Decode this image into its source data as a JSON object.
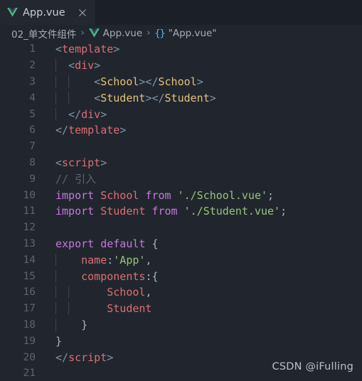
{
  "tab": {
    "icon": "vue-logo-icon",
    "title": "App.vue",
    "close_icon": "close-icon"
  },
  "breadcrumb": {
    "folder": "02_单文件组件",
    "separator": "›",
    "file_icon": "vue-logo-icon",
    "file": "App.vue",
    "symbol_icon": "{}",
    "symbol": "\"App.vue\""
  },
  "editor": {
    "language": "vue",
    "theme_colors": {
      "background": "#21262e",
      "tabbar_background": "#1b1f27",
      "tab_active_background": "#23272f",
      "line_number": "#5a6472",
      "tag": "#e06c75",
      "punctuation": "#7f94a8",
      "component": "#e5c07b",
      "comment": "#5c6370",
      "keyword": "#c678dd",
      "string": "#98c379",
      "plain": "#abb2bf",
      "indent_guide": "#3a4250",
      "vue_green": "#42b883"
    },
    "first_line": 1,
    "last_line": 21,
    "lines": [
      {
        "n": "1",
        "indent": 0,
        "tokens": [
          {
            "c": "t-punct",
            "t": "<"
          },
          {
            "c": "t-tag",
            "t": "template"
          },
          {
            "c": "t-punct",
            "t": ">"
          }
        ]
      },
      {
        "n": "2",
        "indent": 1,
        "tokens": [
          {
            "c": "t-plain",
            "t": "  "
          },
          {
            "c": "t-punct",
            "t": "<"
          },
          {
            "c": "t-tag",
            "t": "div"
          },
          {
            "c": "t-punct",
            "t": ">"
          }
        ]
      },
      {
        "n": "3",
        "indent": 2,
        "tokens": [
          {
            "c": "t-plain",
            "t": "      "
          },
          {
            "c": "t-punct",
            "t": "<"
          },
          {
            "c": "t-comp",
            "t": "School"
          },
          {
            "c": "t-punct",
            "t": "></"
          },
          {
            "c": "t-comp",
            "t": "School"
          },
          {
            "c": "t-punct",
            "t": ">"
          }
        ]
      },
      {
        "n": "4",
        "indent": 2,
        "tokens": [
          {
            "c": "t-plain",
            "t": "      "
          },
          {
            "c": "t-punct",
            "t": "<"
          },
          {
            "c": "t-comp",
            "t": "Student"
          },
          {
            "c": "t-punct",
            "t": "></"
          },
          {
            "c": "t-comp",
            "t": "Student"
          },
          {
            "c": "t-punct",
            "t": ">"
          }
        ]
      },
      {
        "n": "5",
        "indent": 1,
        "tokens": [
          {
            "c": "t-plain",
            "t": "  "
          },
          {
            "c": "t-punct",
            "t": "</"
          },
          {
            "c": "t-tag",
            "t": "div"
          },
          {
            "c": "t-punct",
            "t": ">"
          }
        ]
      },
      {
        "n": "6",
        "indent": 0,
        "tokens": [
          {
            "c": "t-punct",
            "t": "</"
          },
          {
            "c": "t-tag",
            "t": "template"
          },
          {
            "c": "t-punct",
            "t": ">"
          }
        ]
      },
      {
        "n": "7",
        "indent": 0,
        "tokens": []
      },
      {
        "n": "8",
        "indent": 0,
        "tokens": [
          {
            "c": "t-punct",
            "t": "<"
          },
          {
            "c": "t-tag",
            "t": "script"
          },
          {
            "c": "t-punct",
            "t": ">"
          }
        ]
      },
      {
        "n": "9",
        "indent": 0,
        "tokens": [
          {
            "c": "t-comment",
            "t": "// 引入"
          }
        ]
      },
      {
        "n": "10",
        "indent": 0,
        "tokens": [
          {
            "c": "t-kw",
            "t": "import"
          },
          {
            "c": "t-plain",
            "t": " "
          },
          {
            "c": "t-ident",
            "t": "School"
          },
          {
            "c": "t-plain",
            "t": " "
          },
          {
            "c": "t-kw",
            "t": "from"
          },
          {
            "c": "t-plain",
            "t": " "
          },
          {
            "c": "t-str",
            "t": "'./School.vue'"
          },
          {
            "c": "t-plain",
            "t": ";"
          }
        ]
      },
      {
        "n": "11",
        "indent": 0,
        "tokens": [
          {
            "c": "t-kw",
            "t": "import"
          },
          {
            "c": "t-plain",
            "t": " "
          },
          {
            "c": "t-ident",
            "t": "Student"
          },
          {
            "c": "t-plain",
            "t": " "
          },
          {
            "c": "t-kw",
            "t": "from"
          },
          {
            "c": "t-plain",
            "t": " "
          },
          {
            "c": "t-str",
            "t": "'./Student.vue'"
          },
          {
            "c": "t-plain",
            "t": ";"
          }
        ]
      },
      {
        "n": "12",
        "indent": 0,
        "tokens": []
      },
      {
        "n": "13",
        "indent": 0,
        "tokens": [
          {
            "c": "t-kw",
            "t": "export default"
          },
          {
            "c": "t-plain",
            "t": " "
          },
          {
            "c": "t-brace",
            "t": "{"
          }
        ]
      },
      {
        "n": "14",
        "indent": 1,
        "tokens": [
          {
            "c": "t-plain",
            "t": "    "
          },
          {
            "c": "t-prop",
            "t": "name"
          },
          {
            "c": "t-plain",
            "t": ":"
          },
          {
            "c": "t-str",
            "t": "'App'"
          },
          {
            "c": "t-plain",
            "t": ","
          }
        ]
      },
      {
        "n": "15",
        "indent": 1,
        "tokens": [
          {
            "c": "t-plain",
            "t": "    "
          },
          {
            "c": "t-prop",
            "t": "components"
          },
          {
            "c": "t-plain",
            "t": ":"
          },
          {
            "c": "t-brace",
            "t": "{"
          }
        ]
      },
      {
        "n": "16",
        "indent": 2,
        "tokens": [
          {
            "c": "t-plain",
            "t": "        "
          },
          {
            "c": "t-ident",
            "t": "School"
          },
          {
            "c": "t-plain",
            "t": ","
          }
        ]
      },
      {
        "n": "17",
        "indent": 2,
        "tokens": [
          {
            "c": "t-plain",
            "t": "        "
          },
          {
            "c": "t-ident",
            "t": "Student"
          }
        ]
      },
      {
        "n": "18",
        "indent": 1,
        "tokens": [
          {
            "c": "t-plain",
            "t": "    "
          },
          {
            "c": "t-brace",
            "t": "}"
          }
        ]
      },
      {
        "n": "19",
        "indent": 0,
        "tokens": [
          {
            "c": "t-brace",
            "t": "}"
          }
        ]
      },
      {
        "n": "20",
        "indent": 0,
        "tokens": [
          {
            "c": "t-punct",
            "t": "</"
          },
          {
            "c": "t-tag",
            "t": "script"
          },
          {
            "c": "t-punct",
            "t": ">"
          }
        ]
      },
      {
        "n": "21",
        "indent": 0,
        "tokens": []
      }
    ]
  },
  "watermark": "CSDN @iFulling"
}
